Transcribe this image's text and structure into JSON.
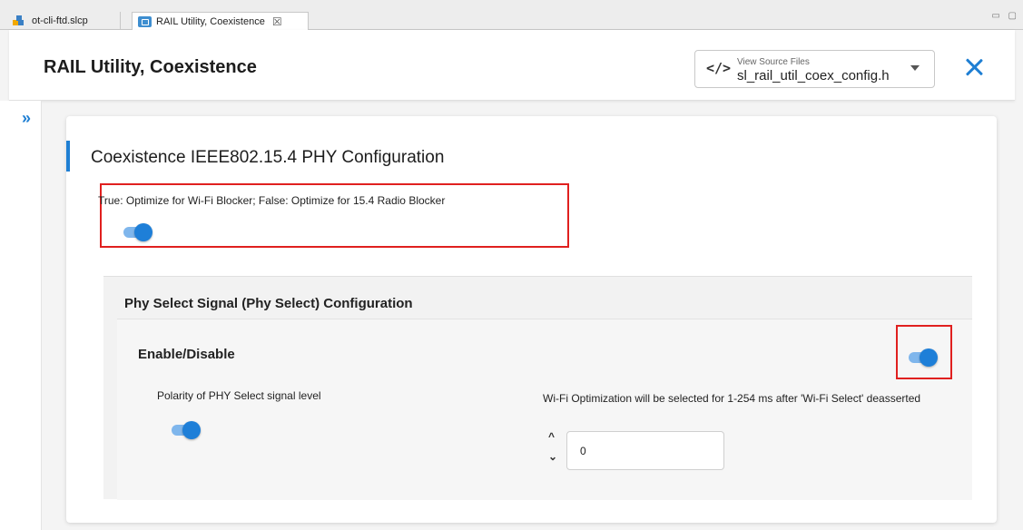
{
  "tabs": [
    {
      "label": "ot-cli-ftd.slcp",
      "icon": "project-icon"
    },
    {
      "label": "RAIL Utility, Coexistence",
      "icon": "component-icon",
      "close": "☒"
    }
  ],
  "header": {
    "title": "RAIL Utility, Coexistence",
    "source_files": {
      "caption": "View Source Files",
      "selected": "sl_rail_util_coex_config.h",
      "icon": "code-icon"
    }
  },
  "sidebar": {
    "expand_icon": "»"
  },
  "section": {
    "title": "Coexistence IEEE802.15.4 PHY Configuration",
    "option_label": "True: Optimize for Wi-Fi Blocker; False: Optimize for 15.4 Radio Blocker",
    "option_on": true
  },
  "phy_select": {
    "title": "Phy Select Signal (Phy Select) Configuration",
    "enable_label": "Enable/Disable",
    "enable_on": true,
    "polarity_label": "Polarity of PHY Select signal level",
    "polarity_on": true,
    "wifi_opt_label": "Wi-Fi Optimization will be selected for 1-254 ms after 'Wi-Fi Select' deasserted",
    "wifi_opt_value": "0",
    "stepper_up": "^",
    "stepper_down": "⌄"
  },
  "colors": {
    "accent": "#1f7fd3",
    "highlight": "#e0201f"
  }
}
